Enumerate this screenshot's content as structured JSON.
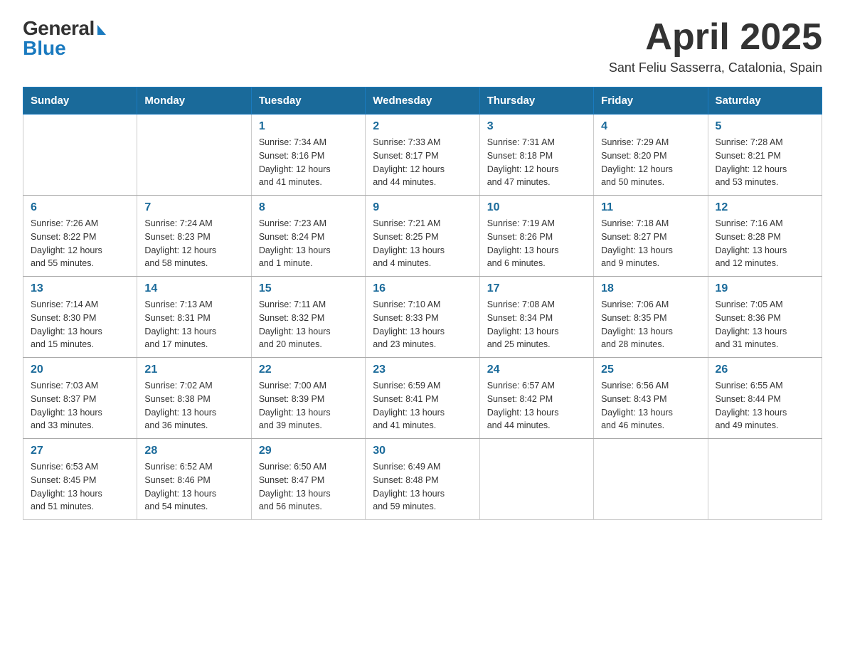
{
  "header": {
    "logo_general": "General",
    "logo_blue": "Blue",
    "month_title": "April 2025",
    "location": "Sant Feliu Sasserra, Catalonia, Spain"
  },
  "weekdays": [
    "Sunday",
    "Monday",
    "Tuesday",
    "Wednesday",
    "Thursday",
    "Friday",
    "Saturday"
  ],
  "weeks": [
    [
      {
        "day": "",
        "info": ""
      },
      {
        "day": "",
        "info": ""
      },
      {
        "day": "1",
        "info": "Sunrise: 7:34 AM\nSunset: 8:16 PM\nDaylight: 12 hours\nand 41 minutes."
      },
      {
        "day": "2",
        "info": "Sunrise: 7:33 AM\nSunset: 8:17 PM\nDaylight: 12 hours\nand 44 minutes."
      },
      {
        "day": "3",
        "info": "Sunrise: 7:31 AM\nSunset: 8:18 PM\nDaylight: 12 hours\nand 47 minutes."
      },
      {
        "day": "4",
        "info": "Sunrise: 7:29 AM\nSunset: 8:20 PM\nDaylight: 12 hours\nand 50 minutes."
      },
      {
        "day": "5",
        "info": "Sunrise: 7:28 AM\nSunset: 8:21 PM\nDaylight: 12 hours\nand 53 minutes."
      }
    ],
    [
      {
        "day": "6",
        "info": "Sunrise: 7:26 AM\nSunset: 8:22 PM\nDaylight: 12 hours\nand 55 minutes."
      },
      {
        "day": "7",
        "info": "Sunrise: 7:24 AM\nSunset: 8:23 PM\nDaylight: 12 hours\nand 58 minutes."
      },
      {
        "day": "8",
        "info": "Sunrise: 7:23 AM\nSunset: 8:24 PM\nDaylight: 13 hours\nand 1 minute."
      },
      {
        "day": "9",
        "info": "Sunrise: 7:21 AM\nSunset: 8:25 PM\nDaylight: 13 hours\nand 4 minutes."
      },
      {
        "day": "10",
        "info": "Sunrise: 7:19 AM\nSunset: 8:26 PM\nDaylight: 13 hours\nand 6 minutes."
      },
      {
        "day": "11",
        "info": "Sunrise: 7:18 AM\nSunset: 8:27 PM\nDaylight: 13 hours\nand 9 minutes."
      },
      {
        "day": "12",
        "info": "Sunrise: 7:16 AM\nSunset: 8:28 PM\nDaylight: 13 hours\nand 12 minutes."
      }
    ],
    [
      {
        "day": "13",
        "info": "Sunrise: 7:14 AM\nSunset: 8:30 PM\nDaylight: 13 hours\nand 15 minutes."
      },
      {
        "day": "14",
        "info": "Sunrise: 7:13 AM\nSunset: 8:31 PM\nDaylight: 13 hours\nand 17 minutes."
      },
      {
        "day": "15",
        "info": "Sunrise: 7:11 AM\nSunset: 8:32 PM\nDaylight: 13 hours\nand 20 minutes."
      },
      {
        "day": "16",
        "info": "Sunrise: 7:10 AM\nSunset: 8:33 PM\nDaylight: 13 hours\nand 23 minutes."
      },
      {
        "day": "17",
        "info": "Sunrise: 7:08 AM\nSunset: 8:34 PM\nDaylight: 13 hours\nand 25 minutes."
      },
      {
        "day": "18",
        "info": "Sunrise: 7:06 AM\nSunset: 8:35 PM\nDaylight: 13 hours\nand 28 minutes."
      },
      {
        "day": "19",
        "info": "Sunrise: 7:05 AM\nSunset: 8:36 PM\nDaylight: 13 hours\nand 31 minutes."
      }
    ],
    [
      {
        "day": "20",
        "info": "Sunrise: 7:03 AM\nSunset: 8:37 PM\nDaylight: 13 hours\nand 33 minutes."
      },
      {
        "day": "21",
        "info": "Sunrise: 7:02 AM\nSunset: 8:38 PM\nDaylight: 13 hours\nand 36 minutes."
      },
      {
        "day": "22",
        "info": "Sunrise: 7:00 AM\nSunset: 8:39 PM\nDaylight: 13 hours\nand 39 minutes."
      },
      {
        "day": "23",
        "info": "Sunrise: 6:59 AM\nSunset: 8:41 PM\nDaylight: 13 hours\nand 41 minutes."
      },
      {
        "day": "24",
        "info": "Sunrise: 6:57 AM\nSunset: 8:42 PM\nDaylight: 13 hours\nand 44 minutes."
      },
      {
        "day": "25",
        "info": "Sunrise: 6:56 AM\nSunset: 8:43 PM\nDaylight: 13 hours\nand 46 minutes."
      },
      {
        "day": "26",
        "info": "Sunrise: 6:55 AM\nSunset: 8:44 PM\nDaylight: 13 hours\nand 49 minutes."
      }
    ],
    [
      {
        "day": "27",
        "info": "Sunrise: 6:53 AM\nSunset: 8:45 PM\nDaylight: 13 hours\nand 51 minutes."
      },
      {
        "day": "28",
        "info": "Sunrise: 6:52 AM\nSunset: 8:46 PM\nDaylight: 13 hours\nand 54 minutes."
      },
      {
        "day": "29",
        "info": "Sunrise: 6:50 AM\nSunset: 8:47 PM\nDaylight: 13 hours\nand 56 minutes."
      },
      {
        "day": "30",
        "info": "Sunrise: 6:49 AM\nSunset: 8:48 PM\nDaylight: 13 hours\nand 59 minutes."
      },
      {
        "day": "",
        "info": ""
      },
      {
        "day": "",
        "info": ""
      },
      {
        "day": "",
        "info": ""
      }
    ]
  ]
}
